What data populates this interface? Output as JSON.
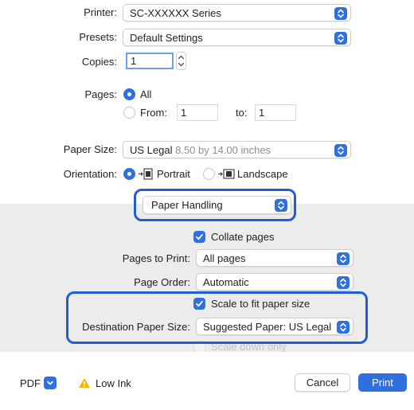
{
  "printer": {
    "label": "Printer:",
    "value": "SC-XXXXXX Series"
  },
  "presets": {
    "label": "Presets:",
    "value": "Default Settings"
  },
  "copies": {
    "label": "Copies:",
    "value": "1"
  },
  "pages": {
    "label": "Pages:",
    "all_label": "All",
    "from_label": "From:",
    "from_value": "1",
    "to_label": "to:",
    "to_value": "1"
  },
  "paper_size": {
    "label": "Paper Size:",
    "value": "US Legal",
    "detail": "8.50 by 14.00 inches"
  },
  "orientation": {
    "label": "Orientation:",
    "portrait_label": "Portrait",
    "landscape_label": "Landscape"
  },
  "section_menu": {
    "value": "Paper Handling"
  },
  "paper_handling": {
    "collate_label": "Collate pages",
    "pages_to_print_label": "Pages to Print:",
    "pages_to_print_value": "All pages",
    "page_order_label": "Page Order:",
    "page_order_value": "Automatic",
    "scale_to_fit_label": "Scale to fit paper size",
    "destination_label": "Destination Paper Size:",
    "destination_value": "Suggested Paper: US Legal",
    "scale_down_label": "Scale down only"
  },
  "footer": {
    "pdf_label": "PDF",
    "warning_label": "Low Ink",
    "cancel_label": "Cancel",
    "print_label": "Print"
  },
  "colors": {
    "accent": "#2f6fe0",
    "highlight": "#1f5fd6",
    "panel_bg": "#ececec",
    "warning": "#f5b400"
  },
  "icons": [
    "chevron-updown-icon",
    "stepper-icon",
    "portrait-orientation-icon",
    "landscape-orientation-icon",
    "checkmark-icon",
    "warning-icon",
    "chevron-down-icon"
  ]
}
